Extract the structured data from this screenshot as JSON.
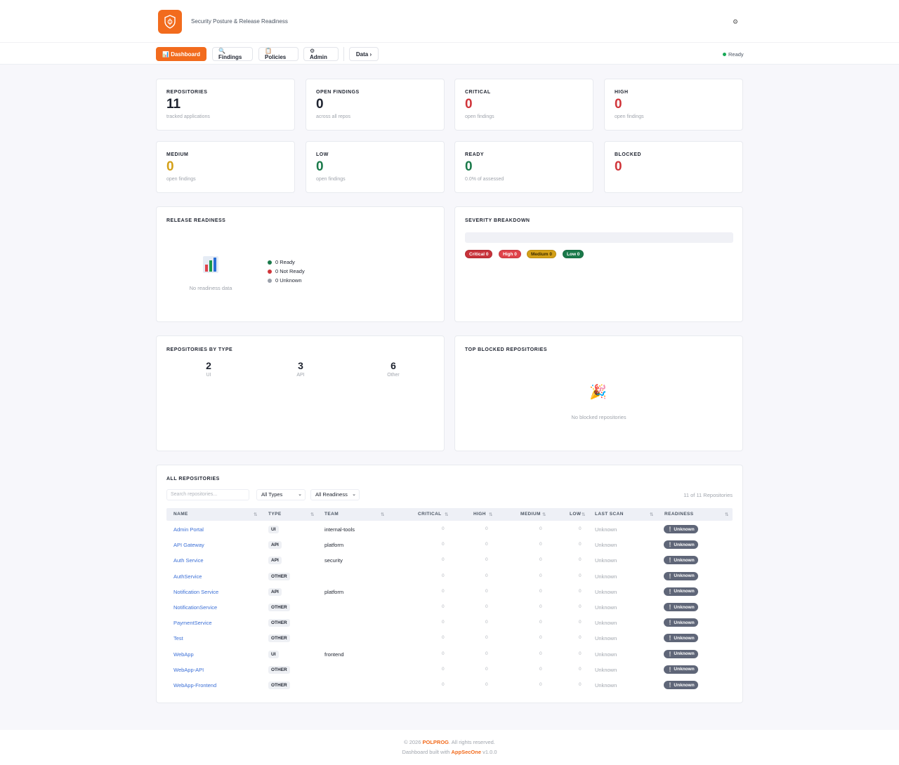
{
  "header": {
    "subtitle": "Security Posture & Release Readiness"
  },
  "nav": {
    "dashboard": "📊 Dashboard",
    "findings": "🔍 Findings",
    "policies": "📋 Policies",
    "admin": "⚙ Admin",
    "data": "Data ›",
    "status": "Ready"
  },
  "stats": [
    {
      "label": "REPOSITORIES",
      "value": "11",
      "sub": "tracked applications",
      "color": "#1f2430"
    },
    {
      "label": "OPEN FINDINGS",
      "value": "0",
      "sub": "across all repos",
      "color": "#1f2430"
    },
    {
      "label": "CRITICAL",
      "value": "0",
      "sub": "open findings",
      "color": "#d0353a"
    },
    {
      "label": "HIGH",
      "value": "0",
      "sub": "open findings",
      "color": "#d0353a"
    },
    {
      "label": "MEDIUM",
      "value": "0",
      "sub": "open findings",
      "color": "#d4a017"
    },
    {
      "label": "LOW",
      "value": "0",
      "sub": "open findings",
      "color": "#1b7a4b"
    },
    {
      "label": "READY",
      "value": "0",
      "sub": "0.0% of assessed",
      "color": "#1b7a4b"
    },
    {
      "label": "BLOCKED",
      "value": "0",
      "sub": "",
      "color": "#d0353a"
    }
  ],
  "readiness": {
    "title": "RELEASE READINESS",
    "empty_icon": "bar-chart-icon",
    "empty_text": "No readiness data",
    "legend": [
      {
        "label": "0 Ready",
        "color": "#1b7a4b"
      },
      {
        "label": "0 Not Ready",
        "color": "#d0353a"
      },
      {
        "label": "0 Unknown",
        "color": "#9aa0aa"
      }
    ]
  },
  "severity": {
    "title": "SEVERITY BREAKDOWN",
    "pills": [
      {
        "label": "Critical 0",
        "color": "#c8323a"
      },
      {
        "label": "High 0",
        "color": "#e0424a"
      },
      {
        "label": "Medium 0",
        "color": "#d4a017"
      },
      {
        "label": "Low 0",
        "color": "#1b7a4b"
      }
    ]
  },
  "by_type": {
    "title": "REPOSITORIES BY TYPE",
    "items": [
      {
        "value": "2",
        "label": "UI"
      },
      {
        "value": "3",
        "label": "API"
      },
      {
        "value": "6",
        "label": "Other"
      }
    ]
  },
  "blocked": {
    "title": "TOP BLOCKED REPOSITORIES",
    "empty_icon": "party-popper-icon",
    "empty_text": "No blocked repositories"
  },
  "repos": {
    "title": "ALL REPOSITORIES",
    "search_placeholder": "Search repositories...",
    "type_filter": "All Types",
    "readiness_filter": "All Readiness",
    "count": "11 of 11 Repositories",
    "columns": [
      "NAME",
      "TYPE",
      "TEAM",
      "CRITICAL",
      "HIGH",
      "MEDIUM",
      "LOW",
      "LAST SCAN",
      "READINESS"
    ],
    "rows": [
      {
        "name": "Admin Portal",
        "type": "UI",
        "team": "internal-tools",
        "critical": "0",
        "high": "0",
        "medium": "0",
        "low": "0",
        "last_scan": "Unknown",
        "readiness": "Unknown"
      },
      {
        "name": "API Gateway",
        "type": "API",
        "team": "platform",
        "critical": "0",
        "high": "0",
        "medium": "0",
        "low": "0",
        "last_scan": "Unknown",
        "readiness": "Unknown"
      },
      {
        "name": "Auth Service",
        "type": "API",
        "team": "security",
        "critical": "0",
        "high": "0",
        "medium": "0",
        "low": "0",
        "last_scan": "Unknown",
        "readiness": "Unknown"
      },
      {
        "name": "AuthService",
        "type": "OTHER",
        "team": "",
        "critical": "0",
        "high": "0",
        "medium": "0",
        "low": "0",
        "last_scan": "Unknown",
        "readiness": "Unknown"
      },
      {
        "name": "Notification Service",
        "type": "API",
        "team": "platform",
        "critical": "0",
        "high": "0",
        "medium": "0",
        "low": "0",
        "last_scan": "Unknown",
        "readiness": "Unknown"
      },
      {
        "name": "NotificationService",
        "type": "OTHER",
        "team": "",
        "critical": "0",
        "high": "0",
        "medium": "0",
        "low": "0",
        "last_scan": "Unknown",
        "readiness": "Unknown"
      },
      {
        "name": "PaymentService",
        "type": "OTHER",
        "team": "",
        "critical": "0",
        "high": "0",
        "medium": "0",
        "low": "0",
        "last_scan": "Unknown",
        "readiness": "Unknown"
      },
      {
        "name": "Test",
        "type": "OTHER",
        "team": "",
        "critical": "0",
        "high": "0",
        "medium": "0",
        "low": "0",
        "last_scan": "Unknown",
        "readiness": "Unknown"
      },
      {
        "name": "WebApp",
        "type": "UI",
        "team": "frontend",
        "critical": "0",
        "high": "0",
        "medium": "0",
        "low": "0",
        "last_scan": "Unknown",
        "readiness": "Unknown"
      },
      {
        "name": "WebApp-API",
        "type": "OTHER",
        "team": "",
        "critical": "0",
        "high": "0",
        "medium": "0",
        "low": "0",
        "last_scan": "Unknown",
        "readiness": "Unknown"
      },
      {
        "name": "WebApp-Frontend",
        "type": "OTHER",
        "team": "",
        "critical": "0",
        "high": "0",
        "medium": "0",
        "low": "0",
        "last_scan": "Unknown",
        "readiness": "Unknown"
      }
    ]
  },
  "footer": {
    "copyright_prefix": "© 2026",
    "brand": "POLPROG",
    "copyright_suffix": ". All rights reserved.",
    "built_prefix": "Dashboard built with",
    "built_brand": "AppSecOne",
    "version": "v1.0.0"
  }
}
